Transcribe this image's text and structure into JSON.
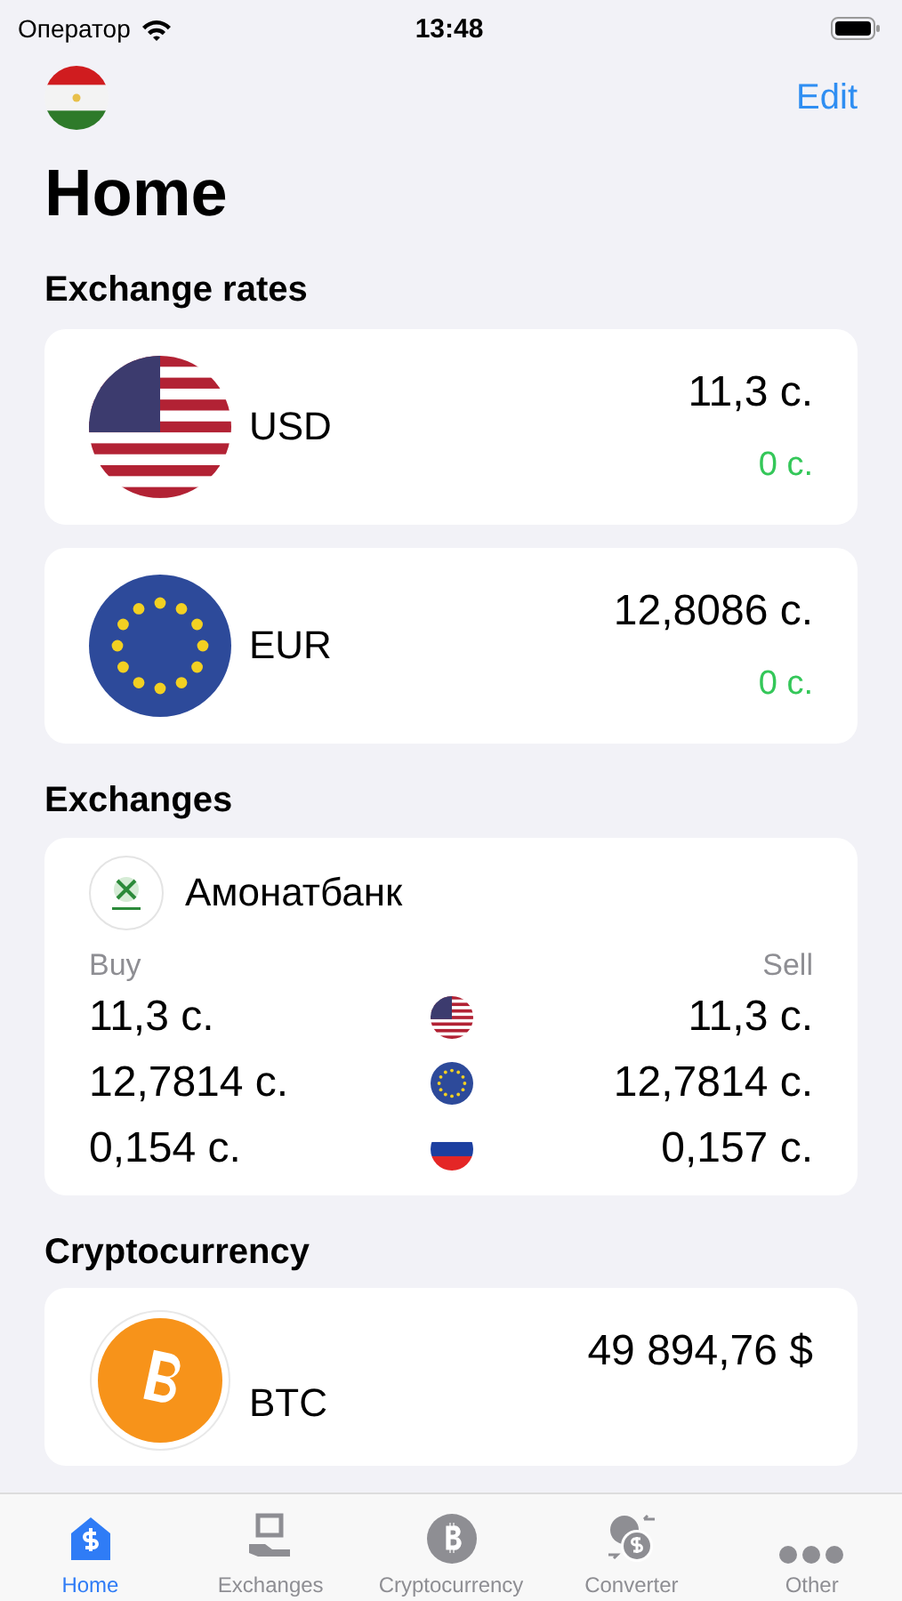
{
  "status_bar": {
    "carrier": "Оператор",
    "time": "13:48"
  },
  "header": {
    "flag": {
      "kind": "tj"
    },
    "edit": "Edit",
    "title": "Home"
  },
  "rates_section": {
    "title": "Exchange rates",
    "items": [
      {
        "kind": "us",
        "code": "USD",
        "value": "11,3 с.",
        "change": "0 с."
      },
      {
        "kind": "eu",
        "code": "EUR",
        "value": "12,8086 с.",
        "change": "0 с."
      }
    ]
  },
  "exchanges_section": {
    "title": "Exchanges",
    "banks": [
      {
        "name": "Амонатбанк",
        "buy_label": "Buy",
        "sell_label": "Sell",
        "rows": [
          {
            "kind": "us",
            "buy": "11,3 с.",
            "sell": "11,3 с."
          },
          {
            "kind": "eu",
            "buy": "12,7814 с.",
            "sell": "12,7814 с."
          },
          {
            "kind": "ru",
            "buy": "0,154 с.",
            "sell": "0,157 с."
          }
        ]
      }
    ]
  },
  "crypto_section": {
    "title": "Cryptocurrency",
    "items": [
      {
        "code": "BTC",
        "value": "49 894,76 $"
      }
    ]
  },
  "tabs": [
    {
      "kind": "home",
      "label": "Home",
      "selected": true
    },
    {
      "kind": "exchange",
      "label": "Exchanges",
      "selected": false
    },
    {
      "kind": "crypto",
      "label": "Cryptocurrency",
      "selected": false
    },
    {
      "kind": "converter",
      "label": "Converter",
      "selected": false
    },
    {
      "kind": "more",
      "label": "Other",
      "selected": false
    }
  ]
}
